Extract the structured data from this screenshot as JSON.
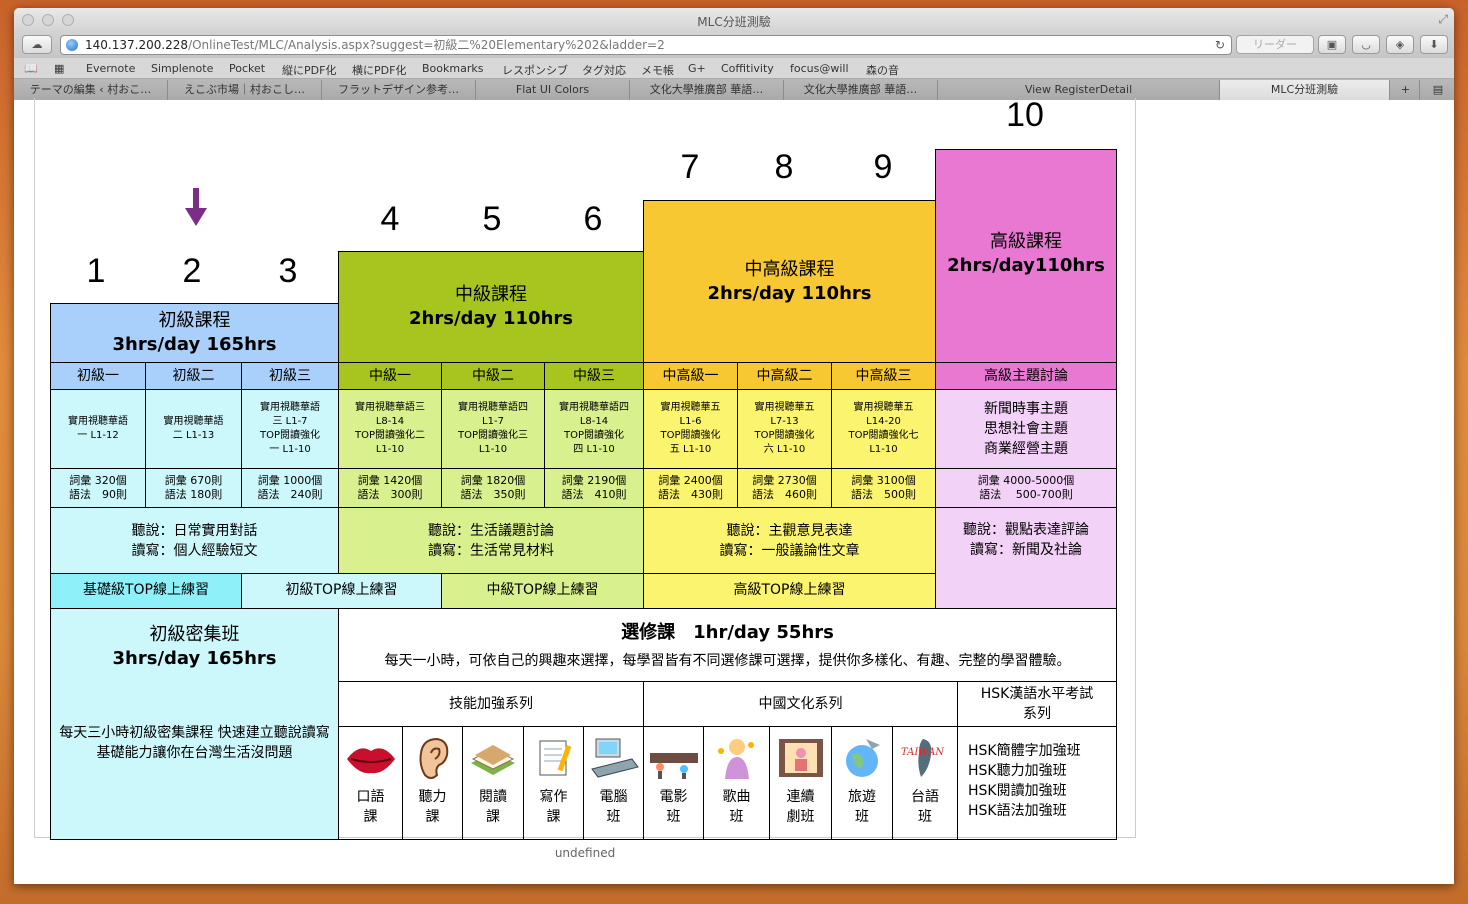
{
  "browser": {
    "title": "MLC分班測驗",
    "url_host": "140.137.200.228",
    "url_path": "/OnlineTest/MLC/Analysis.aspx?suggest=初級二%20Elementary%202&ladder=2",
    "reader_label": "リーダー",
    "bookmarks": [
      "Evernote",
      "Simplenote",
      "Pocket",
      "縦にPDF化",
      "横にPDF化",
      "Bookmarks",
      "レスポンシブ",
      "タグ対応",
      "メモ帳",
      "G+",
      "Coffitivity",
      "focus@will",
      "森の音"
    ],
    "tabs": [
      "テーマの編集 ‹ 村おこ…",
      "えこぶ市場｜村おこし…",
      "フラットデザイン参考…",
      "Flat UI Colors",
      "文化大學推廣部 華語…",
      "文化大學推廣部 華語…",
      "View RegisterDetail",
      "MLC分班測驗"
    ]
  },
  "page": {
    "footer": "undefined",
    "levels": [
      "1",
      "2",
      "3",
      "4",
      "5",
      "6",
      "7",
      "8",
      "9",
      "10"
    ],
    "courses": {
      "elementary": {
        "title": "初級課程",
        "hours": "3hrs/day  165hrs"
      },
      "intermediate": {
        "title": "中級課程",
        "hours": "2hrs/day  110hrs"
      },
      "upper": {
        "title": "中高級課程",
        "hours": "2hrs/day  110hrs"
      },
      "advanced": {
        "title": "高級課程",
        "hours": "2hrs/day110hrs"
      }
    },
    "sublevels": [
      "初級一",
      "初級二",
      "初級三",
      "中級一",
      "中級二",
      "中級三",
      "中高級一",
      "中高級二",
      "中高級三",
      "高級主題討論"
    ],
    "textbooks": [
      [
        "實用視聽華語",
        "一 L1-12"
      ],
      [
        "實用視聽華語",
        "二 L1-13"
      ],
      [
        "實用視聽華語",
        "三 L1-7",
        "TOP閱讀強化",
        "一 L1-10"
      ],
      [
        "實用視聽華語三",
        "L8-14",
        "TOP閱讀強化二",
        "L1-10"
      ],
      [
        "實用視聽華語四",
        "L1-7",
        "TOP閱讀強化三",
        "L1-10"
      ],
      [
        "實用視聽華語四",
        "L8-14",
        "TOP閱讀強化",
        "四 L1-10"
      ],
      [
        "實用視聽華五",
        "L1-6",
        "TOP閱讀強化",
        "五 L1-10"
      ],
      [
        "實用視聽華五",
        "L7-13",
        "TOP閱讀強化",
        "六 L1-10"
      ],
      [
        "實用視聽華五",
        "L14-20",
        "TOP閱讀強化七",
        "L1-10"
      ],
      [
        "新聞時事主題",
        "思想社會主題",
        "商業經營主題"
      ]
    ],
    "vocab": [
      [
        "詞彙 320個",
        "語法　90則"
      ],
      [
        "詞彙 670則",
        "語法 180則"
      ],
      [
        "詞彙 1000個",
        "語法　240則"
      ],
      [
        "詞彙 1420個",
        "語法　300則"
      ],
      [
        "詞彙 1820個",
        "語法　350則"
      ],
      [
        "詞彙 2190個",
        "語法　410則"
      ],
      [
        "詞彙 2400個",
        "語法　430則"
      ],
      [
        "詞彙 2730個",
        "語法　460則"
      ],
      [
        "詞彙 3100個",
        "語法　500則"
      ],
      [
        "詞彙 4000-5000個",
        "語法　 500-700則"
      ]
    ],
    "skills": [
      [
        "聽說：日常實用對話",
        "讀寫：個人經驗短文"
      ],
      [
        "聽說：生活議題討論",
        "讀寫：生活常見材料"
      ],
      [
        "聽說：主觀意見表達",
        "讀寫：一般議論性文章"
      ],
      [
        "聽說：觀點表達評論",
        "讀寫：新聞及社論"
      ]
    ],
    "top_online": [
      "基礎級TOP線上練習",
      "初級TOP線上練習",
      "中級TOP線上練習",
      "高級TOP線上練習"
    ],
    "intensive": {
      "title": "初級密集班",
      "hours": "3hrs/day  165hrs",
      "desc": "每天三小時初級密集課程 快速建立聽說讀寫基礎能力讓你在台灣生活沒問題"
    },
    "elective": {
      "title": "選修課　1hr/day  55hrs",
      "desc": "每天一小時，可依自己的興趣來選擇，每學習皆有不同選修課可選擇，提供你多樣化、有趣、完整的學習體驗。",
      "series": [
        "技能加強系列",
        "中國文化系列",
        "HSK漢語水平考試系列"
      ],
      "classes": [
        {
          "label": "口語課",
          "icon": "lips-icon"
        },
        {
          "label": "聽力課",
          "icon": "ear-icon"
        },
        {
          "label": "閱讀課",
          "icon": "book-icon"
        },
        {
          "label": "寫作課",
          "icon": "notepad-icon"
        },
        {
          "label": "電腦班",
          "icon": "computer-icon"
        },
        {
          "label": "電影班",
          "icon": "film-icon"
        },
        {
          "label": "歌曲班",
          "icon": "singer-icon"
        },
        {
          "label": "連續劇班",
          "icon": "tv-drama-icon"
        },
        {
          "label": "旅遊班",
          "icon": "globe-travel-icon"
        },
        {
          "label": "台語班",
          "icon": "taiwan-icon"
        }
      ],
      "hsk": [
        "HSK簡體字加強班",
        "HSK聽力加強班",
        "HSK閱讀加強班",
        "HSK語法加強班"
      ]
    },
    "colors": {
      "elementary": "#a8d0fa",
      "elementary_light": "#ccf7fb",
      "intermediate": "#a8c41e",
      "intermediate_light": "#d9f08e",
      "upper": "#f8c832",
      "upper_light": "#fbf46e",
      "advanced": "#e878d2",
      "advanced_light": "#f3d2f8",
      "arrow": "#7b2d87",
      "top_basic": "#8ef0f8"
    }
  }
}
